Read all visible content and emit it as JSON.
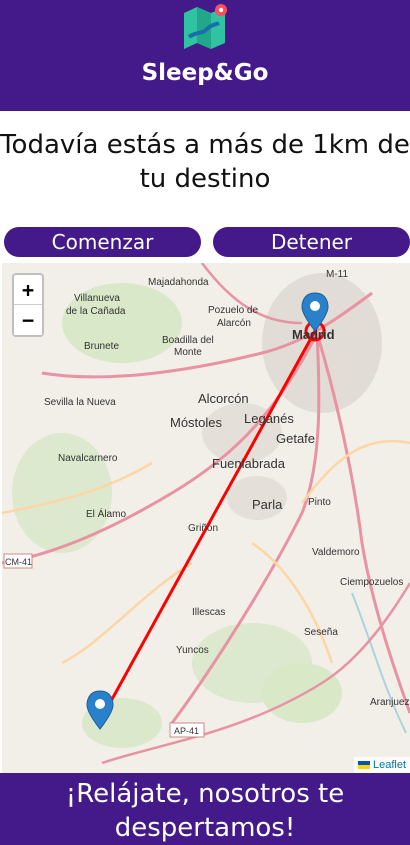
{
  "header": {
    "app_name": "Sleep&Go",
    "background_color": "#44198a",
    "logo_icon": "map-pin-icon"
  },
  "status": {
    "message": "Todavía estás a más de 1km de tu destino"
  },
  "controls": {
    "start_label": "Comenzar",
    "stop_label": "Detener"
  },
  "map": {
    "zoom_in_label": "+",
    "zoom_out_label": "−",
    "attribution": "Leaflet",
    "route_color": "#ff0000",
    "marker_color": "#2a81cb",
    "places": [
      "M-11",
      "Majadahonda",
      "Villanueva de la Cañada",
      "Pozuelo de Alarcón",
      "Madrid",
      "Brunete",
      "Boadilla del Monte",
      "Sevilla la Nueva",
      "Alcorcón",
      "Móstoles",
      "Leganés",
      "Getafe",
      "Navalcarnero",
      "Fuenlabrada",
      "Parla",
      "Pinto",
      "El Álamo",
      "Griñón",
      "Valdemoro",
      "CM-41",
      "Ciempozuelos",
      "Illescas",
      "Seseña",
      "Yuncos",
      "Aranjuez",
      "AP-41"
    ]
  },
  "footer": {
    "message": "¡Relájate, nosotros te despertamos!"
  }
}
